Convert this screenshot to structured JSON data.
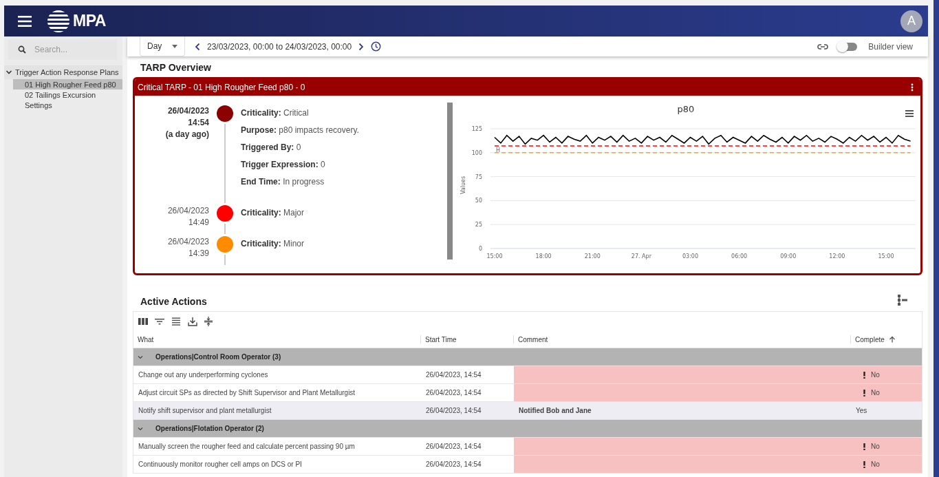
{
  "header": {
    "brand": "MPA",
    "avatar": "A"
  },
  "sidebar": {
    "search_placeholder": "Search...",
    "tree": [
      {
        "label": "Trigger Action Response Plans",
        "expanded": true,
        "children": [
          {
            "label": "01 High Rougher Feed p80",
            "selected": true
          },
          {
            "label": "02 Tailings Excursion",
            "selected": false
          },
          {
            "label": "Settings",
            "selected": false
          }
        ]
      }
    ]
  },
  "toolbar": {
    "period": "Day",
    "range": "23/03/2023, 00:00 to 24/03/2023, 00:00",
    "builder_view": {
      "label": "Builder view",
      "on": false
    }
  },
  "overview": {
    "title": "TARP Overview",
    "card": {
      "title": "Critical TARP - 01 High Rougher Feed p80 - 0",
      "events": [
        {
          "date": "26/04/2023",
          "time": "14:54",
          "ago": "(a day ago)",
          "current": true,
          "color": "#8b0000",
          "fields": [
            {
              "label": "Criticality:",
              "value": "Critical"
            },
            {
              "label": "Purpose:",
              "value": "p80 impacts recovery."
            },
            {
              "label": "Triggered By:",
              "value": "0"
            },
            {
              "label": "Trigger Expression:",
              "value": "0"
            },
            {
              "label": "End Time:",
              "value": "In progress"
            }
          ]
        },
        {
          "date": "26/04/2023",
          "time": "14:49",
          "current": false,
          "color": "#ff0000",
          "fields": [
            {
              "label": "Criticality:",
              "value": "Major"
            }
          ]
        },
        {
          "date": "26/04/2023",
          "time": "14:39",
          "current": false,
          "color": "#ff8c00",
          "fields": [
            {
              "label": "Criticality:",
              "value": "Minor"
            }
          ]
        }
      ]
    },
    "chart": {
      "chart_data": {
        "type": "line",
        "title": "p80",
        "ylabel": "Values",
        "ylim": [
          0,
          125
        ],
        "categories": [
          "15:00",
          null,
          null,
          null,
          null,
          null,
          null,
          null,
          "18:00",
          null,
          null,
          null,
          null,
          null,
          null,
          null,
          "21:00",
          null,
          null,
          null,
          null,
          null,
          null,
          null,
          "27. Apr",
          null,
          null,
          null,
          null,
          null,
          null,
          null,
          "03:00",
          null,
          null,
          null,
          null,
          null,
          null,
          null,
          "06:00",
          null,
          null,
          null,
          null,
          null,
          null,
          null,
          "09:00",
          null,
          null,
          null,
          null,
          null,
          null,
          null,
          "12:00",
          null,
          null,
          null,
          null,
          null,
          null,
          null,
          "15:00",
          null,
          null,
          null,
          null
        ],
        "yticks": [
          0,
          25,
          50,
          75,
          100,
          125
        ],
        "grid": true,
        "series": [
          {
            "color": "#000000",
            "line_style": "solid",
            "values": [
              116,
              110,
              118,
              112,
              117,
              109,
              115,
              113,
              118,
              111,
              116,
              110,
              117,
              114,
              112,
              118,
              110,
              116,
              113,
              117,
              111,
              118,
              112,
              115,
              110,
              117,
              113,
              116,
              111,
              118,
              114,
              110,
              116,
              112,
              117,
              109,
              115,
              118,
              111,
              116,
              113,
              110,
              117,
              112,
              118,
              114,
              111,
              116,
              110,
              117,
              113,
              118,
              112,
              115,
              111,
              117,
              114,
              110,
              116,
              112,
              118,
              113,
              117,
              111,
              116,
              110,
              118,
              114,
              112
            ]
          },
          {
            "name": "H",
            "color": "#ff0000",
            "line_style": "dashed",
            "values": [
              107,
              107,
              107,
              107,
              107,
              107,
              107,
              107,
              107,
              107,
              107,
              107,
              107,
              107,
              107,
              107,
              107,
              107,
              107,
              107,
              107,
              107,
              107,
              107,
              107,
              107,
              107,
              107,
              107,
              107,
              107,
              107,
              107,
              107,
              107,
              107,
              107,
              107,
              107,
              107,
              107,
              107,
              107,
              107,
              107,
              107,
              107,
              107,
              107,
              107,
              107,
              107,
              107,
              107,
              107,
              107,
              107,
              107,
              107,
              107,
              107,
              107,
              107,
              107,
              107,
              107,
              107,
              107,
              107
            ]
          },
          {
            "color": "#f5a623",
            "line_style": "dashed",
            "values": [
              100,
              100,
              100,
              100,
              100,
              100,
              100,
              100,
              100,
              100,
              100,
              100,
              100,
              100,
              100,
              100,
              100,
              100,
              100,
              100,
              100,
              100,
              100,
              100,
              100,
              100,
              100,
              100,
              100,
              100,
              100,
              100,
              100,
              100,
              100,
              100,
              100,
              100,
              100,
              100,
              100,
              100,
              100,
              100,
              100,
              100,
              100,
              100,
              100,
              100,
              100,
              100,
              100,
              100,
              100,
              100,
              100,
              100,
              100,
              100,
              100,
              100,
              100,
              100,
              100,
              100,
              100,
              100,
              100
            ]
          }
        ]
      }
    }
  },
  "actions": {
    "title": "Active Actions",
    "columns": [
      {
        "label": "What",
        "sorted": false
      },
      {
        "label": "Start Time",
        "sorted": false
      },
      {
        "label": "Comment",
        "sorted": false
      },
      {
        "label": "Complete",
        "sorted": true
      }
    ],
    "groups": [
      {
        "label": "Operations|Control Room Operator (3)",
        "expanded": true,
        "rows": [
          {
            "what": "Change out any underperforming cyclones",
            "start": "26/04/2023, 14:54",
            "complete": "No",
            "done": false,
            "selected": false
          },
          {
            "what": "Adjust circuit SPs as directed by Shift Supervisor and Plant Metallurgist",
            "start": "26/04/2023, 14:54",
            "complete": "No",
            "done": false,
            "selected": false
          },
          {
            "what": "Notify shift supervisor and plant metallurgist",
            "start": "26/04/2023, 14:54",
            "comment": "Notified Bob and Jane",
            "complete": "Yes",
            "done": true,
            "selected": true
          }
        ]
      },
      {
        "label": "Operations|Flotation Operator (2)",
        "expanded": true,
        "rows": [
          {
            "what": "Manually screen the rougher feed and calculate percent passing 90 µm",
            "start": "26/04/2023, 14:54",
            "complete": "No",
            "done": false,
            "selected": false
          },
          {
            "what": "Continuously monitor rougher cell amps on DCS or PI",
            "start": "26/04/2023, 14:54",
            "complete": "No",
            "done": false,
            "selected": false
          }
        ]
      }
    ]
  }
}
